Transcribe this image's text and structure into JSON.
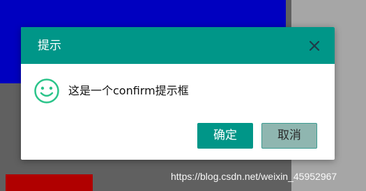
{
  "dialog": {
    "title": "提示",
    "message": "这是一个confirm提示框",
    "confirm_label": "确定",
    "cancel_label": "取消",
    "icons": {
      "close": "close-icon",
      "status": "smile-icon"
    }
  },
  "watermark": {
    "text": "https://blog.csdn.net/weixin_45952967"
  },
  "colors": {
    "primary": "#009688",
    "cancel_bg": "#8fb6b0",
    "background_blue": "#0000c0",
    "background_red": "#b00000",
    "background_gray": "#606060",
    "background_light": "#a6a6a6"
  }
}
